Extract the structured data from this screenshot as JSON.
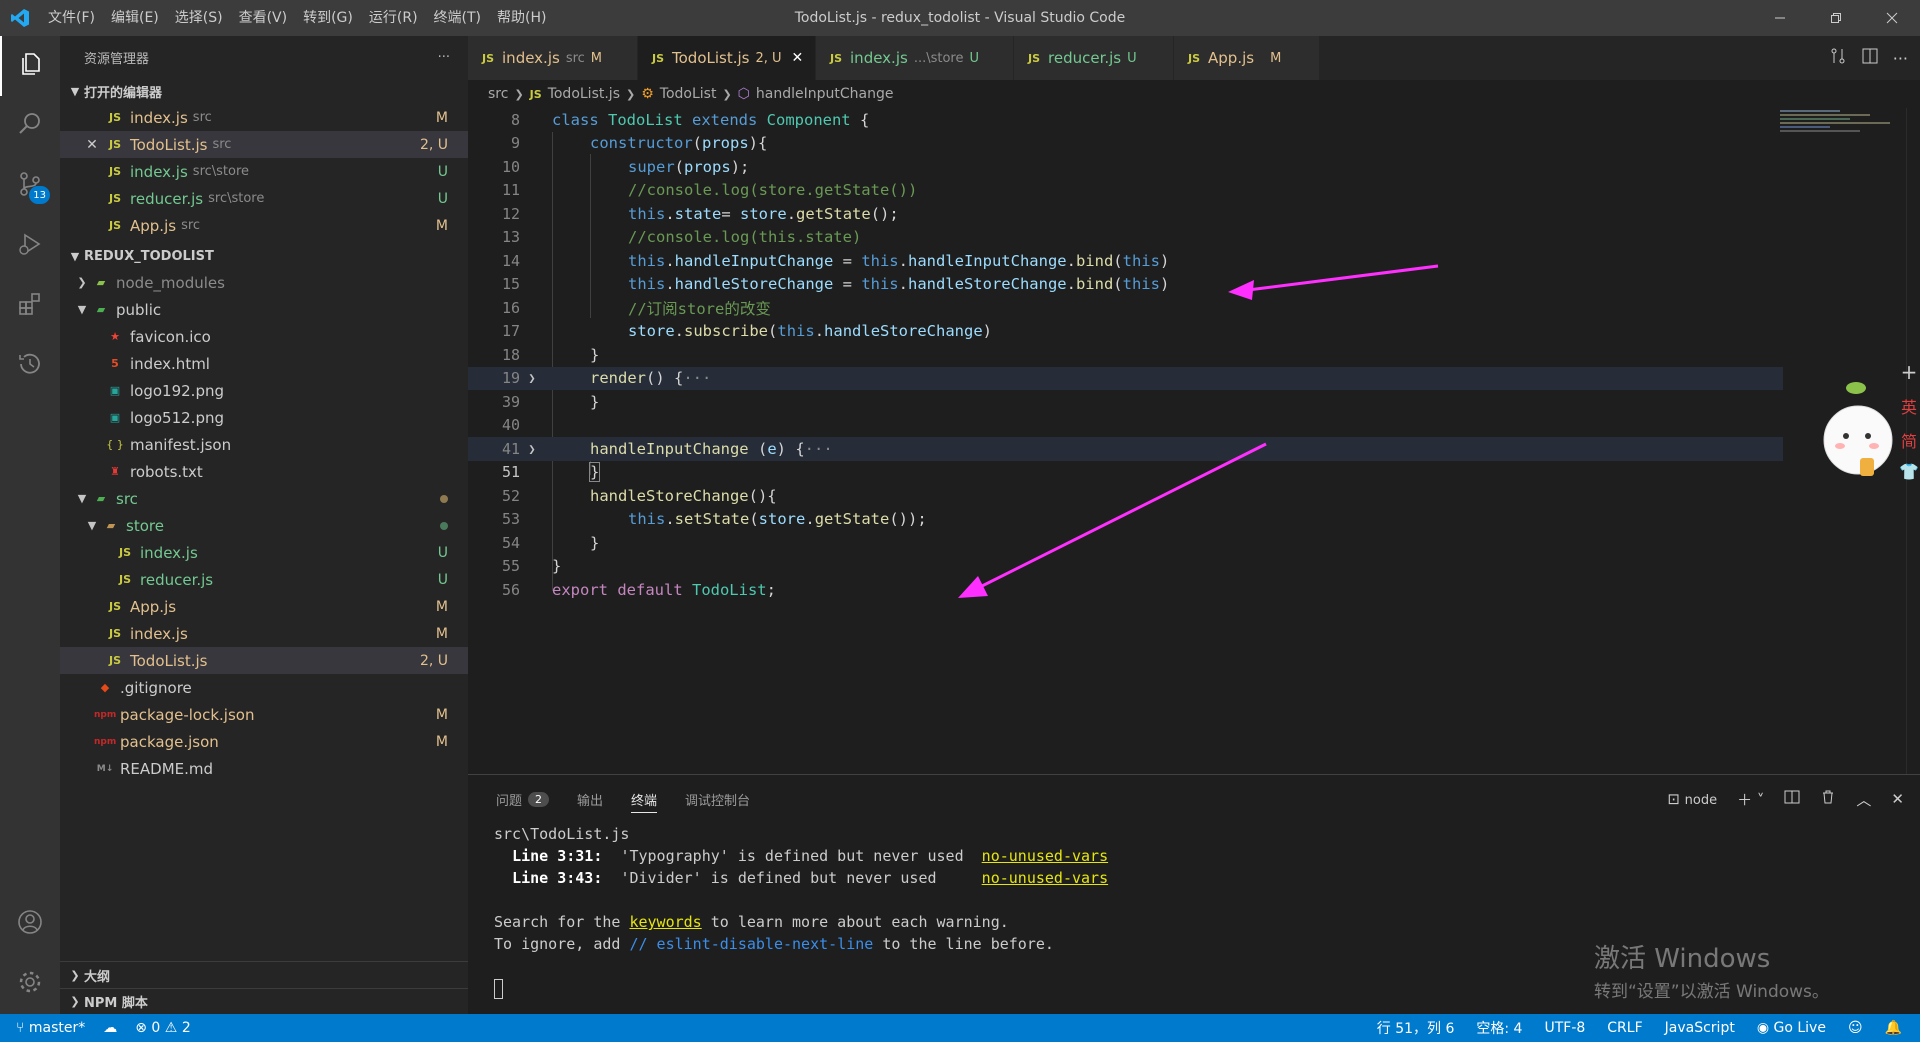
{
  "window": {
    "title": "TodoList.js - redux_todolist - Visual Studio Code",
    "menu": [
      "文件(F)",
      "编辑(E)",
      "选择(S)",
      "查看(V)",
      "转到(G)",
      "运行(R)",
      "终端(T)",
      "帮助(H)"
    ]
  },
  "activity": {
    "scm_badge": "13"
  },
  "sidebar": {
    "header": "资源管理器",
    "more": "···",
    "open_editors_title": "打开的编辑器",
    "open_editors": [
      {
        "name": "index.js",
        "path": "src",
        "status": "M"
      },
      {
        "name": "TodoList.js",
        "path": "src",
        "status": "2, U"
      },
      {
        "name": "index.js",
        "path": "src\\store",
        "status": "U"
      },
      {
        "name": "reducer.js",
        "path": "src\\store",
        "status": "U"
      },
      {
        "name": "App.js",
        "path": "src",
        "status": "M"
      }
    ],
    "project_title": "REDUX_TODOLIST",
    "tree": [
      {
        "name": "node_modules",
        "status": ""
      },
      {
        "name": "public",
        "status": ""
      },
      {
        "name": "favicon.ico",
        "status": ""
      },
      {
        "name": "index.html",
        "status": ""
      },
      {
        "name": "logo192.png",
        "status": ""
      },
      {
        "name": "logo512.png",
        "status": ""
      },
      {
        "name": "manifest.json",
        "status": ""
      },
      {
        "name": "robots.txt",
        "status": ""
      },
      {
        "name": "src",
        "status": ""
      },
      {
        "name": "store",
        "status": ""
      },
      {
        "name": "index.js",
        "status": "U"
      },
      {
        "name": "reducer.js",
        "status": "U"
      },
      {
        "name": "App.js",
        "status": "M"
      },
      {
        "name": "index.js",
        "status": "M"
      },
      {
        "name": "TodoList.js",
        "status": "2, U"
      },
      {
        "name": ".gitignore",
        "status": ""
      },
      {
        "name": "package-lock.json",
        "status": "M"
      },
      {
        "name": "package.json",
        "status": "M"
      },
      {
        "name": "README.md",
        "status": ""
      }
    ],
    "outline_title": "大纲",
    "npm_title": "NPM 脚本"
  },
  "tabs": [
    {
      "name": "index.js",
      "desc": "src",
      "status": "M"
    },
    {
      "name": "TodoList.js",
      "desc": "",
      "status": "2, U",
      "close": "✕"
    },
    {
      "name": "index.js",
      "desc": "...\\store",
      "status": "U"
    },
    {
      "name": "reducer.js",
      "desc": "",
      "status": "U"
    },
    {
      "name": "App.js",
      "desc": "",
      "status": "M"
    }
  ],
  "breadcrumb": [
    "src",
    "TodoList.js",
    "TodoList",
    "handleInputChange"
  ],
  "code": {
    "line_numbers": [
      "8",
      "9",
      "10",
      "11",
      "12",
      "13",
      "14",
      "15",
      "16",
      "17",
      "18",
      "19",
      "39",
      "40",
      "41",
      "51",
      "52",
      "53",
      "54",
      "55",
      "56"
    ],
    "lines": {
      "l8": [
        "class ",
        "TodoList",
        " extends ",
        "Component",
        " {"
      ],
      "l9": [
        "constructor",
        "(",
        "props",
        "){"
      ],
      "l10": [
        "super",
        "(",
        "props",
        ");"
      ],
      "l11": "//console.log(store.getState())",
      "l12": [
        "this",
        ".",
        "state",
        "= ",
        "store",
        ".",
        "getState",
        "();"
      ],
      "l13": "//console.log(this.state)",
      "l14": [
        "this",
        ".",
        "handleInputChange",
        " = ",
        "this",
        ".",
        "handleInputChange",
        ".",
        "bind",
        "(",
        "this",
        ")"
      ],
      "l15": [
        "this",
        ".",
        "handleStoreChange",
        " = ",
        "this",
        ".",
        "handleStoreChange",
        ".",
        "bind",
        "(",
        "this",
        ")"
      ],
      "l16": "//订阅store的改变",
      "l17": [
        "store",
        ".",
        "subscribe",
        "(",
        "this",
        ".",
        "handleStoreChange",
        ")"
      ],
      "l18": "}",
      "l19": [
        "render",
        "() {",
        "···"
      ],
      "l39": "}",
      "l40": "",
      "l41": [
        "handleInputChange",
        " (",
        "e",
        ") {",
        "···"
      ],
      "l51": "}",
      "l52": [
        "handleStoreChange",
        "(){"
      ],
      "l53": [
        "this",
        ".",
        "setState",
        "(",
        "store",
        ".",
        "getState",
        "());"
      ],
      "l54": "}",
      "l55": "}",
      "l56": [
        "export ",
        "default ",
        "TodoList",
        ";"
      ]
    }
  },
  "panel": {
    "tabs": [
      "问题",
      "输出",
      "终端",
      "调试控制台"
    ],
    "problem_count": "2",
    "terminal_name": "node",
    "terminal": {
      "file": "src\\TodoList.js",
      "w1_loc": "Line 3:31:",
      "w1_msg": "'Typography' is defined but never used",
      "w1_rule": "no-unused-vars",
      "w2_loc": "Line 3:43:",
      "w2_msg": "'Divider' is defined but never used",
      "w2_rule": "no-unused-vars",
      "s1_a": "Search for the ",
      "s1_kw": "keywords",
      "s1_b": " to learn more about each warning.",
      "s2_a": "To ignore, add ",
      "s2_code": "// eslint-disable-next-line",
      "s2_b": " to the line before."
    }
  },
  "watermark": {
    "line1": "激活 Windows",
    "line2": "转到“设置”以激活 Windows。"
  },
  "ime": [
    "英",
    "简"
  ],
  "statusbar": {
    "branch": "master*",
    "errors": "0",
    "warnings": "2",
    "position": "行 51，列 6",
    "spaces": "空格: 4",
    "encoding": "UTF-8",
    "eol": "CRLF",
    "language": "JavaScript",
    "golive": "Go Live"
  }
}
